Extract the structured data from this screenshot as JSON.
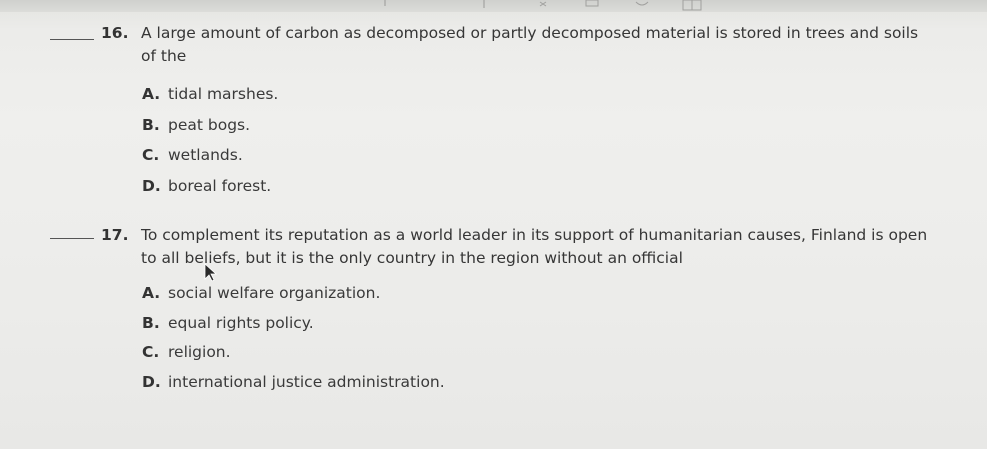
{
  "questions": [
    {
      "number": "16.",
      "lines": [
        "A large amount of carbon as decomposed or partly decomposed material is stored in trees and soils",
        "of the"
      ],
      "choices": [
        {
          "letter": "A.",
          "text": "tidal marshes."
        },
        {
          "letter": "B.",
          "text": "peat bogs."
        },
        {
          "letter": "C.",
          "text": "wetlands."
        },
        {
          "letter": "D.",
          "text": "boreal forest."
        }
      ]
    },
    {
      "number": "17.",
      "lines": [
        "To complement its reputation as a world leader in its support of humanitarian causes, Finland is open",
        "to all beliefs, but it is the only country in the region without an official"
      ],
      "choices": [
        {
          "letter": "A.",
          "text": "social welfare organization."
        },
        {
          "letter": "B.",
          "text": "equal rights policy."
        },
        {
          "letter": "C.",
          "text": "religion."
        },
        {
          "letter": "D.",
          "text": "international justice administration."
        }
      ]
    }
  ]
}
